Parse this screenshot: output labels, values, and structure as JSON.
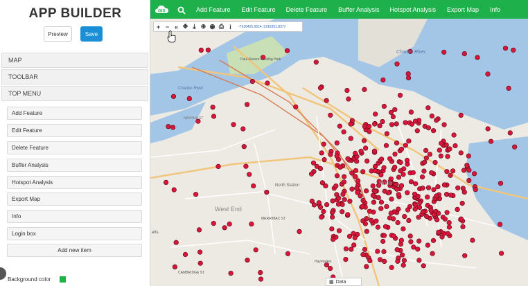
{
  "app": {
    "title": "APP BUILDER"
  },
  "actions": {
    "preview_label": "Preview",
    "save_label": "Save"
  },
  "panels": [
    {
      "label": "MAP"
    },
    {
      "label": "TOOLBAR"
    },
    {
      "label": "TOP MENU"
    }
  ],
  "menu_items": [
    {
      "label": "Add Feature"
    },
    {
      "label": "Edit Feature"
    },
    {
      "label": "Delete Feature"
    },
    {
      "label": "Buffer Analysis"
    },
    {
      "label": "Hotspot Analysis"
    },
    {
      "label": "Export Map"
    },
    {
      "label": "Info"
    },
    {
      "label": "Login box"
    }
  ],
  "add_item_label": "Add new item",
  "background": {
    "label": "Background color",
    "color": "#1cb34a"
  },
  "topnav": {
    "logo": "GIS",
    "items": [
      "Add Feature",
      "Edit Feature",
      "Delete Feature",
      "Buffer Analysis",
      "Hotspot Analysis",
      "Export Map",
      "Info"
    ]
  },
  "map_toolbar": {
    "coords": "-7910425.0614, 5216351.8377"
  },
  "data_tab": {
    "label": "Data"
  },
  "map_labels": {
    "charles_river": "Charles River",
    "charles_river_2": "Charles River",
    "north_station": "North Station",
    "west_end": "West End",
    "paul_revere": "Paul Revere Landing Park",
    "haymarket": "Haymarket",
    "nashua": "NASHUA ST",
    "cambridge": "CAMBRIDGE ST",
    "merrimac": "MERRIMAC ST",
    "mystic": "Mystic River",
    "north": "North",
    "jets": "etts"
  }
}
